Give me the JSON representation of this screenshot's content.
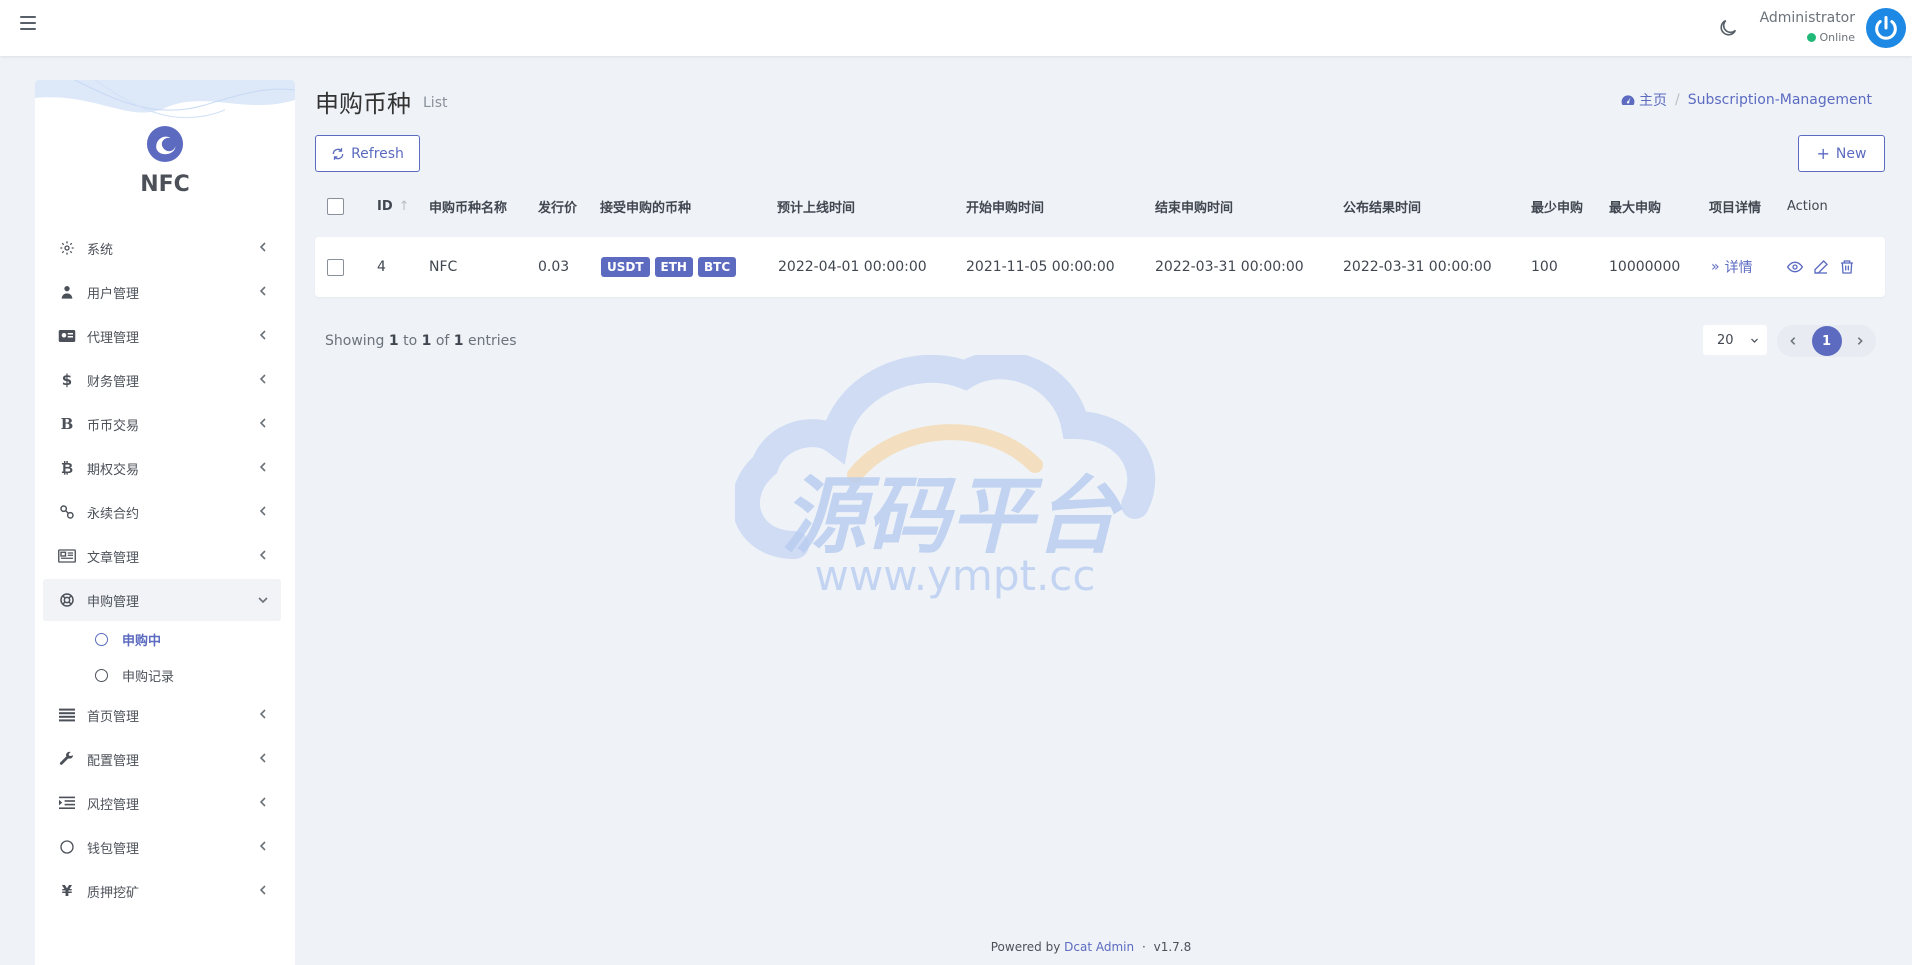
{
  "navbar": {
    "user_name": "Administrator",
    "user_status": "Online"
  },
  "sidebar": {
    "brand": "NFC",
    "items": [
      {
        "label": "系统",
        "icon": "gear-icon"
      },
      {
        "label": "用户管理",
        "icon": "user-icon"
      },
      {
        "label": "代理管理",
        "icon": "id-card-icon"
      },
      {
        "label": "财务管理",
        "icon": "dollar-icon"
      },
      {
        "label": "币币交易",
        "icon": "b-icon"
      },
      {
        "label": "期权交易",
        "icon": "bitcoin-icon"
      },
      {
        "label": "永续合约",
        "icon": "link-icon"
      },
      {
        "label": "文章管理",
        "icon": "newspaper-icon"
      },
      {
        "label": "申购管理",
        "icon": "lifebuoy-icon"
      },
      {
        "label": "首页管理",
        "icon": "list-icon"
      },
      {
        "label": "配置管理",
        "icon": "wrench-icon"
      },
      {
        "label": "风控管理",
        "icon": "indent-icon"
      },
      {
        "label": "钱包管理",
        "icon": "circle-icon"
      },
      {
        "label": "质押挖矿",
        "icon": "yen-icon"
      }
    ],
    "sub_items": [
      {
        "label": "申购中"
      },
      {
        "label": "申购记录"
      }
    ]
  },
  "header": {
    "title": "申购币种",
    "subtitle": "List",
    "breadcrumb_home": "主页",
    "breadcrumb_sep": "/",
    "breadcrumb_current": "Subscription-Management"
  },
  "toolbar": {
    "refresh_label": "Refresh",
    "new_label": "New"
  },
  "table": {
    "columns": [
      "ID",
      "申购币种名称",
      "发行价",
      "接受申购的币种",
      "预计上线时间",
      "开始申购时间",
      "结束申购时间",
      "公布结果时间",
      "最少申购",
      "最大申购",
      "项目详情",
      "Action"
    ],
    "rows": [
      {
        "id": "4",
        "name": "NFC",
        "price": "0.03",
        "coins": [
          "USDT",
          "ETH",
          "BTC"
        ],
        "online_time": "2022-04-01 00:00:00",
        "start_time": "2021-11-05 00:00:00",
        "end_time": "2022-03-31 00:00:00",
        "result_time": "2022-03-31 00:00:00",
        "min": "100",
        "max": "10000000",
        "detail": "详情"
      }
    ]
  },
  "pagination": {
    "showing_prefix": "Showing",
    "from": "1",
    "to_word": "to",
    "to": "1",
    "of_word": "of",
    "total": "1",
    "entries_word": "entries",
    "per_page": "20",
    "current_page": "1"
  },
  "watermark": {
    "title": "源码平台",
    "url": "www.ympt.cc"
  },
  "footer": {
    "powered_by": "Powered by",
    "brand": "Dcat Admin",
    "dot": "·",
    "version": "v1.7.8"
  },
  "colors": {
    "accent": "#5c6bc0",
    "online": "#21b978",
    "avatar": "#1e88e5"
  }
}
